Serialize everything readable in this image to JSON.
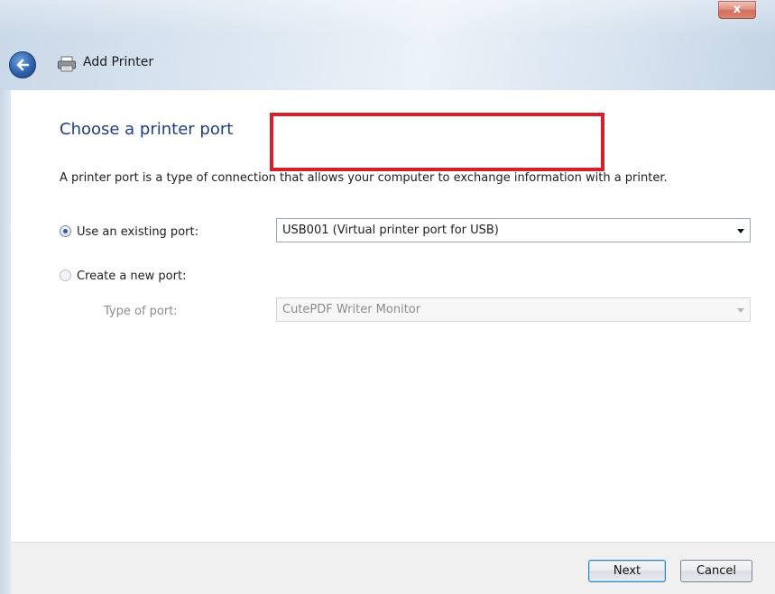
{
  "window": {
    "title": "Add Printer",
    "close_glyph": "x"
  },
  "page": {
    "heading": "Choose a printer port",
    "description": "A printer port is a type of connection that allows your computer to exchange information with a printer."
  },
  "options": {
    "existing_port_label": "Use an existing port:",
    "existing_port_checked": true,
    "existing_port_value": "USB001 (Virtual printer port for USB)",
    "new_port_label": "Create a new port:",
    "new_port_checked": false,
    "type_of_port_label": "Type of port:",
    "type_of_port_value": "CutePDF Writer Monitor"
  },
  "buttons": {
    "next": "Next",
    "cancel": "Cancel"
  },
  "icons": {
    "back": "back-arrow-icon",
    "printer": "printer-icon",
    "close": "close-icon"
  },
  "colors": {
    "heading": "#1e3e8a",
    "highlight": "#d4202a",
    "close_button": "#c2412a"
  }
}
